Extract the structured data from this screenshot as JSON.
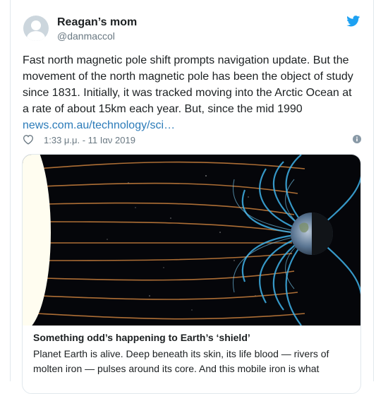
{
  "author": {
    "display_name": "Reagan’s mom",
    "handle": "@danmaccol",
    "avatar_icon": "default-profile-icon"
  },
  "brand": {
    "icon": "twitter-bird-icon",
    "color": "#1da1f2"
  },
  "tweet": {
    "text_lines": [
      "Fast north magnetic pole shift prompts navigation update. But the",
      "movement of the north magnetic pole has been the object of study",
      "since 1831. Initially, it was tracked moving into the Arctic Ocean at",
      "a rate of about 15km each year. But, since the mid 1990"
    ],
    "link": "news.com.au/technology/sci…",
    "link_color": "#2b7bb9"
  },
  "meta": {
    "like_icon": "heart-icon",
    "timestamp": "1:33 μ.μ. - 11 Ιαν 2019",
    "info_icon": "info-icon"
  },
  "card": {
    "image": "sun-magnetosphere-earth-illustration",
    "title": "Something odd’s happening to Earth’s ‘shield’",
    "description_lines": [
      "Planet Earth is alive. Deep beneath its skin, its life blood — rivers of",
      "molten iron — pulses around its core. And this mobile iron is what"
    ]
  }
}
